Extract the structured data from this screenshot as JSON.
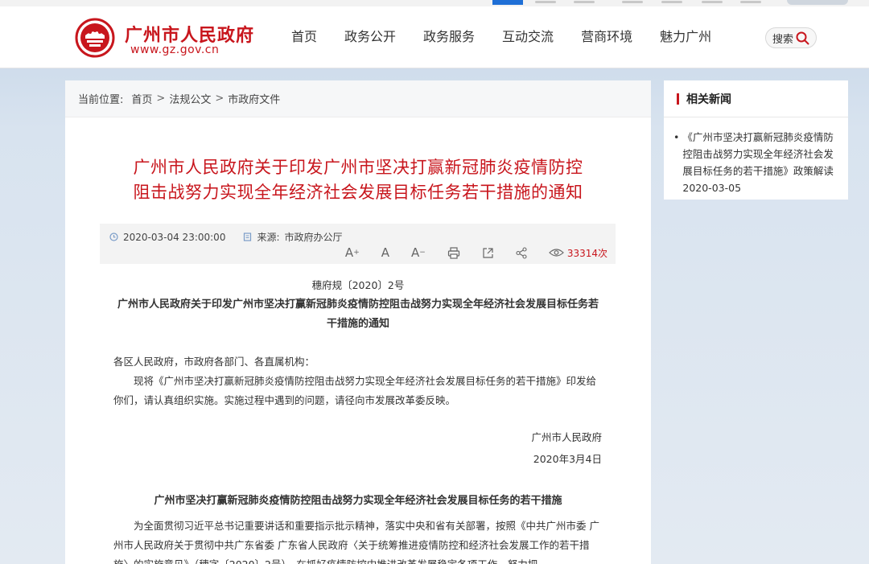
{
  "header": {
    "site_name": "广州市人民政府",
    "site_url": "www.gz.gov.cn",
    "nav": [
      "首页",
      "政务公开",
      "政务服务",
      "互动交流",
      "营商环境",
      "魅力广州"
    ],
    "search_label": "搜索"
  },
  "breadcrumb": {
    "label": "当前位置:",
    "items": [
      "首页",
      "法规公文",
      "市政府文件"
    ]
  },
  "article": {
    "title_line1": "广州市人民政府关于印发广州市坚决打赢新冠肺炎疫情防控",
    "title_line2": "阻击战努力实现全年经济社会发展目标任务若干措施的通知",
    "date": "2020-03-04 23:00:00",
    "source_label": "来源:",
    "source": "市政府办公厅",
    "views": "33314次",
    "doc_number": "穗府规〔2020〕2号",
    "doc_title": "广州市人民政府关于印发广州市坚决打赢新冠肺炎疫情防控阻击战努力实现全年经济社会发展目标任务若干措施的通知",
    "greeting": "各区人民政府，市政府各部门、各直属机构：",
    "body1": "现将《广州市坚决打赢新冠肺炎疫情防控阻击战努力实现全年经济社会发展目标任务的若干措施》印发给你们，请认真组织实施。实施过程中遇到的问题，请径向市发展改革委反映。",
    "signer": "广州市人民政府",
    "sign_date": "2020年3月4日",
    "section_title": "广州市坚决打赢新冠肺炎疫情防控阻击战努力实现全年经济社会发展目标任务的若干措施",
    "body2": "为全面贯彻习近平总书记重要讲话和重要指示批示精神，落实中央和省有关部署，按照《中共广州市委 广州市人民政府关于贯彻中共广东省委 广东省人民政府〈关于统筹推进疫情防控和经济社会发展工作的若干措施〉的实施意见》（穗字〔2020〕2号），在抓好疫情防控中推进改革发展稳定各项工作，努力把"
  },
  "side": {
    "heading": "相关新闻",
    "news_title": "《广州市坚决打赢新冠肺炎疫情防控阻击战努力实现全年经济社会发展目标任务的若干措施》政策解读",
    "news_date": "2020-03-05"
  },
  "colors": {
    "brand_red": "#c8161d",
    "accent_blue": "#1f6fd6"
  },
  "icons": [
    "clock-icon",
    "document-icon",
    "font-increase-icon",
    "font-normal-icon",
    "font-decrease-icon",
    "print-icon",
    "share-external-icon",
    "share-icon",
    "eye-icon",
    "search-icon",
    "government-emblem-logo"
  ]
}
